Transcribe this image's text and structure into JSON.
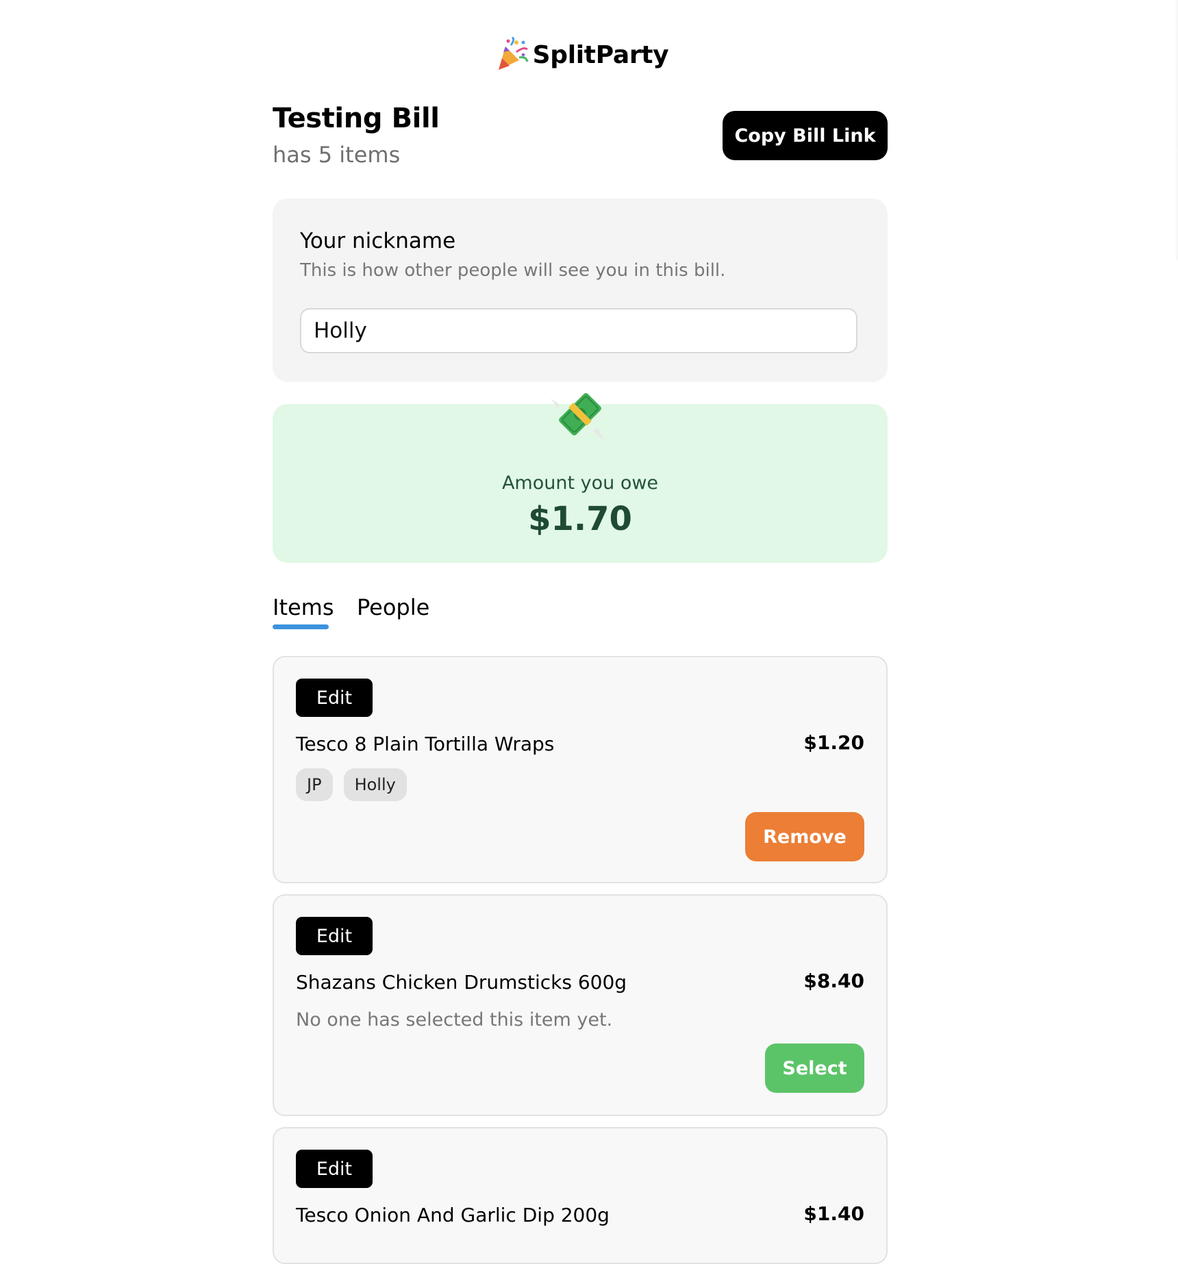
{
  "app": {
    "name": "SplitParty",
    "logo_icon": "party-popper-icon"
  },
  "bill": {
    "title": "Testing Bill",
    "item_count_text": "has 5 items",
    "copy_link_label": "Copy Bill Link"
  },
  "nickname": {
    "label": "Your nickname",
    "hint": "This is how other people will see you in this bill.",
    "value": "Holly"
  },
  "owe": {
    "icon": "money-with-wings-icon",
    "label": "Amount you owe",
    "amount": "$1.70"
  },
  "tabs": [
    {
      "label": "Items",
      "active": true
    },
    {
      "label": "People",
      "active": false
    }
  ],
  "items": [
    {
      "edit_label": "Edit",
      "name": "Tesco 8 Plain Tortilla Wraps",
      "price": "$1.20",
      "people": [
        "JP",
        "Holly"
      ],
      "action_label": "Remove"
    },
    {
      "edit_label": "Edit",
      "name": "Shazans Chicken Drumsticks 600g",
      "price": "$8.40",
      "empty_text": "No one has selected this item yet.",
      "action_label": "Select"
    },
    {
      "edit_label": "Edit",
      "name": "Tesco Onion And Garlic Dip 200g",
      "price": "$1.40"
    }
  ],
  "colors": {
    "accent_tab": "#3d93dd",
    "remove": "#ec7e36",
    "select": "#5cc468",
    "owe_bg": "#e1f8e6",
    "owe_text": "#1f4a34"
  }
}
